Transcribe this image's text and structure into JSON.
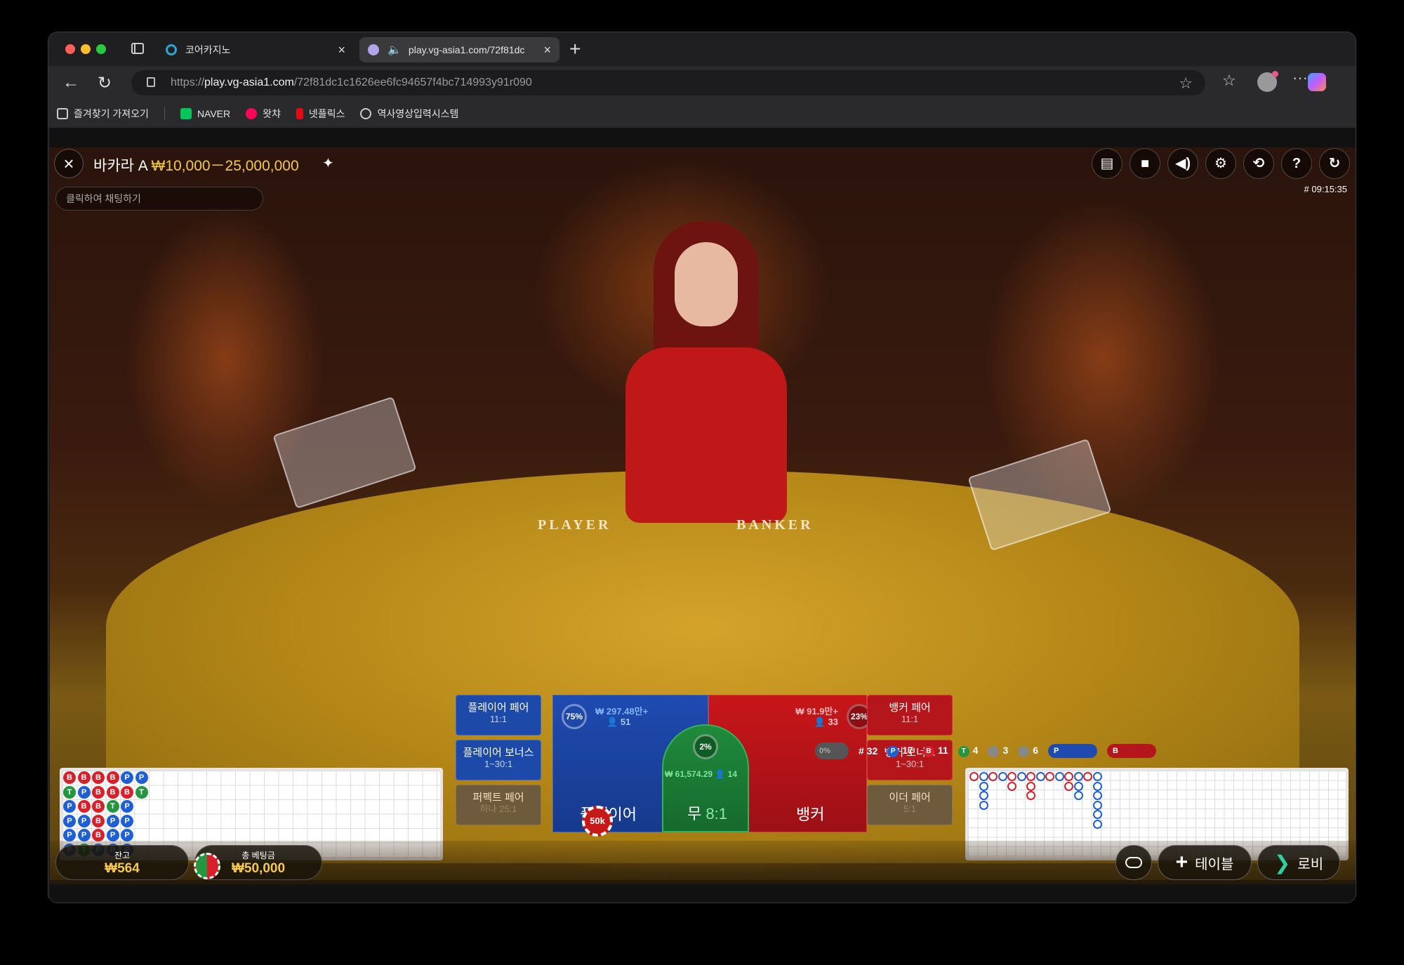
{
  "browser": {
    "tabs": [
      {
        "title": "코어카지노",
        "active": false
      },
      {
        "title": "play.vg-asia1.com/72f81dc",
        "active": true
      }
    ],
    "url": {
      "scheme": "https://",
      "host": "play.vg-asia1.com",
      "path": "/72f81dc1c1626ee6fc94657f4bc714993y91r090"
    },
    "bookmarks": [
      {
        "label": "즐겨찾기 가져오기",
        "icon": "import-icon"
      },
      {
        "label": "NAVER",
        "icon": "naver-icon",
        "color": "#03c75a"
      },
      {
        "label": "왓챠",
        "icon": "watcha-icon",
        "color": "#ff0558"
      },
      {
        "label": "넷플릭스",
        "icon": "netflix-icon",
        "color": "#e50914"
      },
      {
        "label": "역사영상입력시스템",
        "icon": "globe-icon"
      }
    ]
  },
  "game": {
    "close_icon": "×",
    "table_name": "바카라 A",
    "limits": "₩10,000－25,000,000",
    "chat_placeholder": "클릭하여 채팅하기",
    "round_time": "# 09:15:35",
    "table_labels": {
      "player": "PLAYER",
      "banker": "BANKER"
    },
    "tools": [
      "chat-icon",
      "video-icon",
      "volume-icon",
      "settings-icon",
      "history-icon",
      "help-icon",
      "refresh-icon"
    ],
    "tool_glyphs": [
      "▤",
      "■",
      "◀)",
      "⚙",
      "⟲",
      "?",
      "↻"
    ],
    "side_bets": {
      "player_pair": {
        "label": "플레이어 페어",
        "odds": "11:1"
      },
      "player_bonus": {
        "label": "플레이어 보너스",
        "odds": "1~30:1"
      },
      "perfect_pair": {
        "label": "퍼펙트 페어",
        "odds": "하나 25:1"
      },
      "banker_pair": {
        "label": "뱅커 페어",
        "odds": "11:1"
      },
      "banker_bonus": {
        "label": "뱅커 보너스",
        "odds": "1~30:1"
      },
      "either_pair": {
        "label": "이더 페어",
        "odds": "5:1"
      }
    },
    "main_bets": {
      "player": {
        "label": "플레이어",
        "percent": "75%",
        "amount": "₩ 297.48만+",
        "players": "51"
      },
      "tie": {
        "label": "무",
        "odds": "8:1",
        "percent": "2%",
        "amount": "₩ 61,574.29",
        "players": "14"
      },
      "banker": {
        "label": "뱅커",
        "percent": "23%",
        "amount": "₩ 91.9만+",
        "players": "33"
      }
    },
    "chip": "50k",
    "road_stats": {
      "toggle": "0%",
      "round": "# 32",
      "player": "17",
      "banker": "11",
      "tie": "4",
      "player_pair": "3",
      "banker_pair": "6",
      "player_predict": "P",
      "banker_predict": "B"
    },
    "bead_road": [
      [
        "B",
        "T",
        "P",
        "P",
        "P",
        "P"
      ],
      [
        "B",
        "P",
        "B",
        "P",
        "P",
        "T"
      ],
      [
        "B",
        "B",
        "B",
        "B",
        "B",
        "P"
      ],
      [
        "B",
        "B",
        "T",
        "P",
        "P",
        "P"
      ],
      [
        "P",
        "B",
        "P",
        "P",
        "P",
        "P"
      ],
      [
        "P",
        "T",
        "",
        "",
        "",
        ""
      ]
    ],
    "balance": {
      "label": "잔고",
      "value": "₩564"
    },
    "total_bet": {
      "label": "총 베팅금",
      "value": "₩50,000"
    },
    "buttons": {
      "table": "테이블",
      "lobby": "로비"
    }
  }
}
